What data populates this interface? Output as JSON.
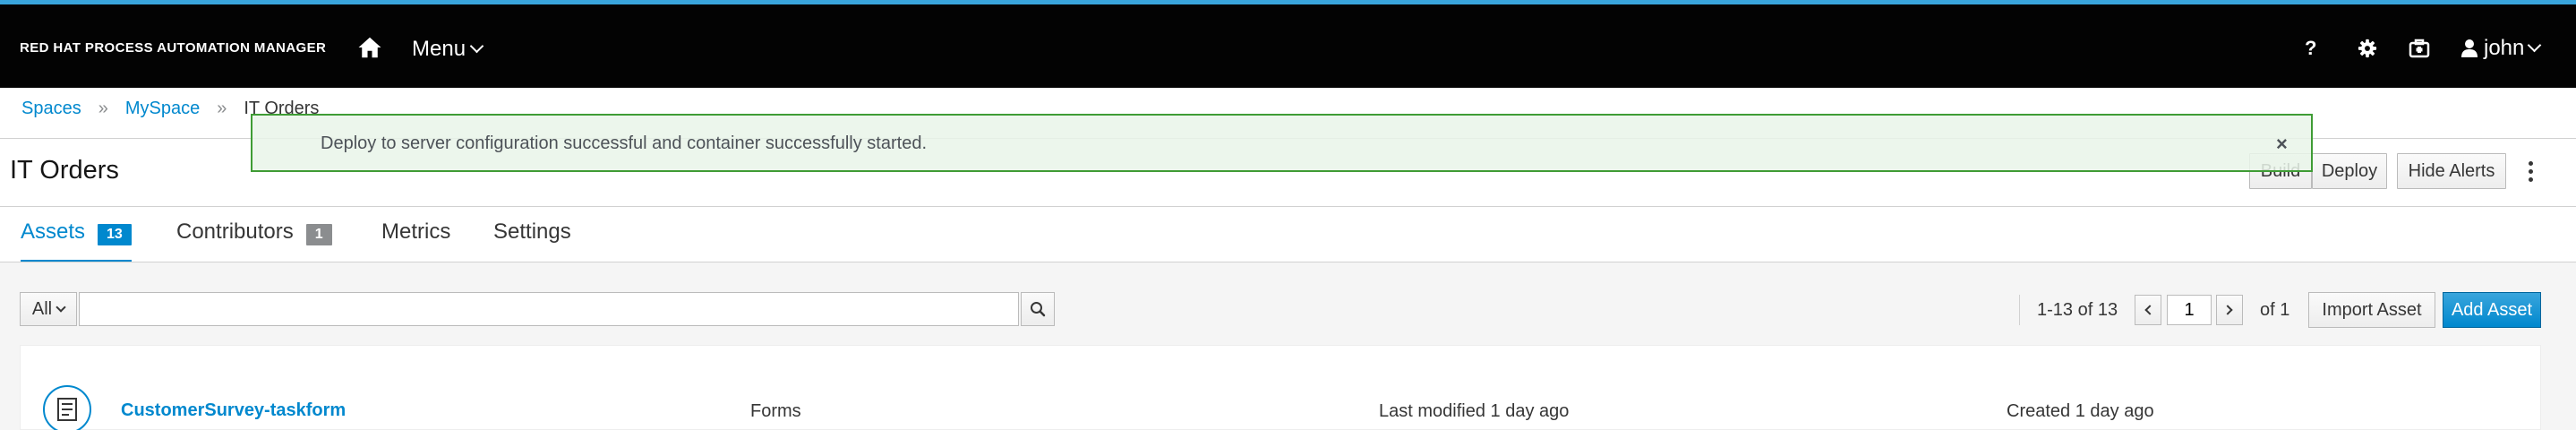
{
  "masthead": {
    "brand": "RED HAT PROCESS AUTOMATION MANAGER",
    "menu_label": "Menu",
    "help_label": "?",
    "user_name": "john",
    "accent_color": "#39a5dc",
    "background_color": "#030303",
    "icons": [
      "home-icon",
      "chevron-down-icon",
      "gear-icon",
      "tasks-icon",
      "user-icon"
    ]
  },
  "breadcrumb": {
    "items": [
      "Spaces",
      "MySpace",
      "IT Orders"
    ],
    "separator": "»"
  },
  "page": {
    "title": "IT Orders"
  },
  "actions": {
    "build_label": "Build",
    "deploy_label": "Deploy",
    "hide_alerts_label": "Hide Alerts"
  },
  "alert": {
    "message": "Deploy to server configuration successful and container successfully started.",
    "close_label": "×",
    "type": "success",
    "border_color": "#3f9c35"
  },
  "tabs": {
    "items": [
      {
        "label": "Assets",
        "count": "13",
        "active": true
      },
      {
        "label": "Contributors",
        "count": "1",
        "active": false
      },
      {
        "label": "Metrics",
        "active": false
      },
      {
        "label": "Settings",
        "active": false
      }
    ]
  },
  "toolbar": {
    "filter_value": "All",
    "search_value": "",
    "search_placeholder": "",
    "pagination_range": "1-13 of 13",
    "current_page": "1",
    "total_pages_label": "of 1",
    "import_label": "Import Asset",
    "add_label": "Add Asset",
    "primary_color": "#0088ce"
  },
  "assets": [
    {
      "name": "CustomerSurvey-taskform",
      "type": "Forms",
      "modified": "Last modified 1 day ago",
      "created": "Created 1 day ago",
      "icon": "form-icon"
    }
  ]
}
